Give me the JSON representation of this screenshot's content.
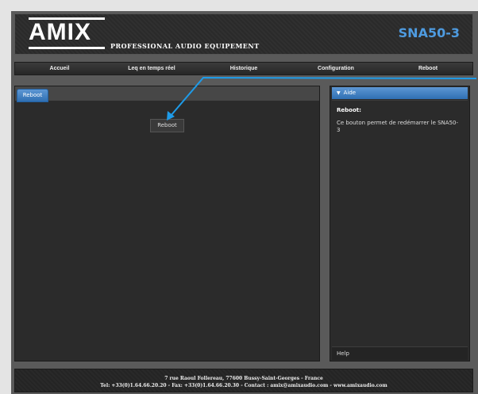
{
  "header": {
    "logo": "AMIX",
    "subtitle": "PROFESSIONAL AUDIO EQUIPEMENT",
    "model": "SNA50-3"
  },
  "nav": [
    "Accueil",
    "Leq en temps réel",
    "Historique",
    "Configuration",
    "Reboot"
  ],
  "main": {
    "tab_label": "Reboot",
    "reboot_button": "Reboot"
  },
  "aide": {
    "header": "Aide",
    "title": "Reboot:",
    "text": "Ce bouton permet de redémarrer le SNA50-3",
    "help_label": "Help"
  },
  "footer": {
    "line1": "7 rue Raoul Follereau, 77600 Bussy-Saint-Georges - France",
    "line2": "Tel: +33(0)1.64.66.20.20 - Fax: +33(0)1.64.66.20.30 - Contact : amix@amixaudio.com - www.amixaudio.com"
  },
  "colors": {
    "accent": "#4e9be0",
    "annotation_arrow": "#1e9be8"
  }
}
